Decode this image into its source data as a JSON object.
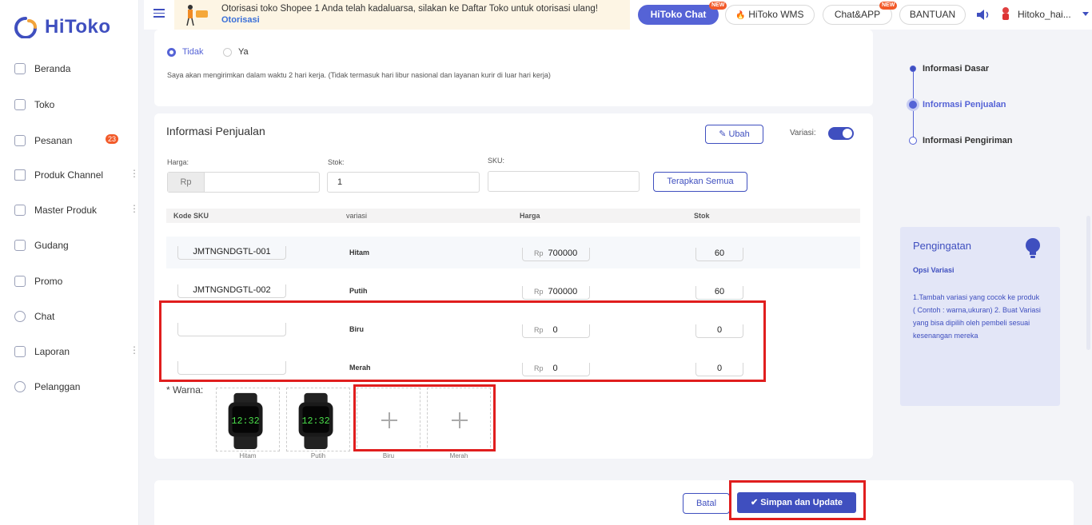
{
  "app": {
    "logo_text": "HiToko"
  },
  "sidebar": {
    "items": [
      {
        "label": "Beranda"
      },
      {
        "label": "Toko"
      },
      {
        "label": "Pesanan",
        "badge": "23"
      },
      {
        "label": "Produk Channel"
      },
      {
        "label": "Master Produk"
      },
      {
        "label": "Gudang"
      },
      {
        "label": "Promo"
      },
      {
        "label": "Chat"
      },
      {
        "label": "Laporan"
      },
      {
        "label": "Pelanggan"
      }
    ]
  },
  "topbar": {
    "notice_text": "Otorisasi toko Shopee 1 Anda telah kadaluarsa, silakan ke Daftar Toko untuk otorisasi ulang!",
    "notice_link": "Otorisasi",
    "hitoko_chat": "HiToko Chat",
    "hitoko_wms": "HiToko WMS",
    "chat_app": "Chat&APP",
    "bantuan": "BANTUAN",
    "new_tag": "NEW",
    "user_name": "Hitoko_hai..."
  },
  "shipping": {
    "radio_no": "Tidak",
    "radio_yes": "Ya",
    "selected": "Tidak",
    "note": "Saya akan mengirimkan dalam waktu 2 hari kerja. (Tidak termasuk hari libur nasional dan layanan kurir di luar hari kerja)"
  },
  "sales": {
    "title": "Informasi Penjualan",
    "edit_button": "Ubah",
    "variation_label": "Variasi:",
    "variation_enabled": true,
    "price_label": "Harga:",
    "price_prefix": "Rp",
    "price_value": "",
    "stock_label": "Stok:",
    "stock_value": "1",
    "sku_label": "SKU:",
    "sku_value": "",
    "apply_all_button": "Terapkan Semua",
    "table": {
      "headers": [
        "Kode SKU",
        "variasi",
        "Harga",
        "Stok"
      ],
      "rows": [
        {
          "sku": "JMTNGNDGTL-001",
          "variant": "Hitam",
          "currency": "Rp",
          "price": "700000",
          "stock": "60"
        },
        {
          "sku": "JMTNGNDGTL-002",
          "variant": "Putih",
          "currency": "Rp",
          "price": "700000",
          "stock": "60"
        },
        {
          "sku": "",
          "variant": "Biru",
          "currency": "Rp",
          "price": "0",
          "stock": "0"
        },
        {
          "sku": "",
          "variant": "Merah",
          "currency": "Rp",
          "price": "0",
          "stock": "0"
        }
      ]
    },
    "color_label": "* Warna:",
    "color_images": [
      {
        "caption": "Hitam",
        "has_image": true
      },
      {
        "caption": "Putih",
        "has_image": true
      },
      {
        "caption": "Biru",
        "has_image": false
      },
      {
        "caption": "Merah",
        "has_image": false
      }
    ]
  },
  "steps": {
    "items": [
      {
        "label": "Informasi Dasar"
      },
      {
        "label": "Informasi Penjualan"
      },
      {
        "label": "Informasi Pengiriman"
      }
    ],
    "active": "Informasi Penjualan"
  },
  "tip": {
    "title": "Pengingatan",
    "subtitle": "Opsi Variasi",
    "body": "1.Tambah variasi yang cocok ke produk ( Contoh : warna,ukuran) 2. Buat Variasi yang bisa dipilih oleh pembeli sesuai kesenangan mereka"
  },
  "footer": {
    "cancel_button": "Batal",
    "save_button": "Simpan dan Update"
  },
  "colors": {
    "accent": "#3f4fbf",
    "highlight": "#e01e1e",
    "badge": "#f25a29"
  }
}
